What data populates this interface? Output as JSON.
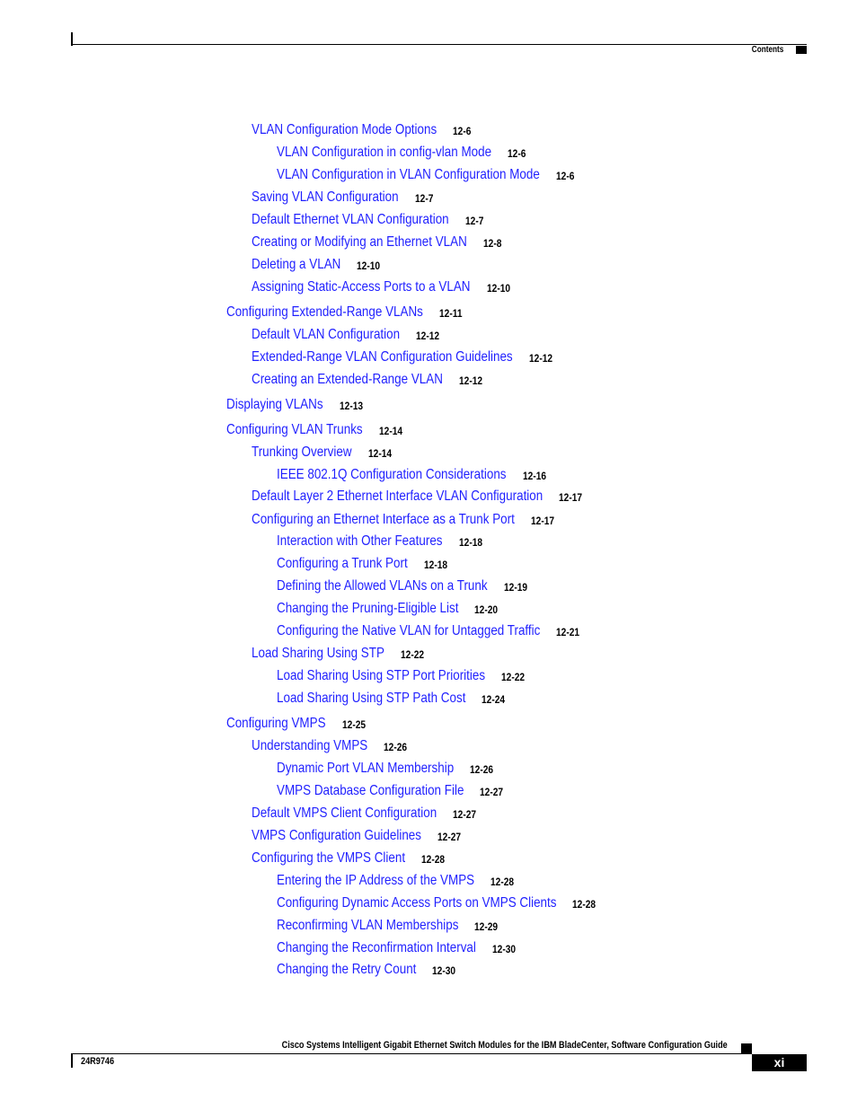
{
  "header": {
    "section_label": "Contents"
  },
  "toc": {
    "entries": [
      {
        "level": 2,
        "title": "VLAN Configuration Mode Options",
        "page": "12-6"
      },
      {
        "level": 3,
        "title": "VLAN Configuration in config-vlan Mode",
        "page": "12-6"
      },
      {
        "level": 3,
        "title": "VLAN Configuration in VLAN Configuration Mode",
        "page": "12-6"
      },
      {
        "level": 2,
        "title": "Saving VLAN Configuration",
        "page": "12-7"
      },
      {
        "level": 2,
        "title": "Default Ethernet VLAN Configuration",
        "page": "12-7"
      },
      {
        "level": 2,
        "title": "Creating or Modifying an Ethernet VLAN",
        "page": "12-8"
      },
      {
        "level": 2,
        "title": "Deleting a VLAN",
        "page": "12-10"
      },
      {
        "level": 2,
        "title": "Assigning Static-Access Ports to a VLAN",
        "page": "12-10"
      },
      {
        "level": 1,
        "title": "Configuring Extended-Range VLANs",
        "page": "12-11"
      },
      {
        "level": 2,
        "title": "Default VLAN Configuration",
        "page": "12-12"
      },
      {
        "level": 2,
        "title": "Extended-Range VLAN Configuration Guidelines",
        "page": "12-12"
      },
      {
        "level": 2,
        "title": "Creating an Extended-Range VLAN",
        "page": "12-12"
      },
      {
        "level": 1,
        "title": "Displaying VLANs",
        "page": "12-13"
      },
      {
        "level": 1,
        "title": "Configuring VLAN Trunks",
        "page": "12-14"
      },
      {
        "level": 2,
        "title": "Trunking Overview",
        "page": "12-14"
      },
      {
        "level": 3,
        "title": "IEEE 802.1Q Configuration Considerations",
        "page": "12-16"
      },
      {
        "level": 2,
        "title": "Default Layer 2 Ethernet Interface VLAN Configuration",
        "page": "12-17"
      },
      {
        "level": 2,
        "title": "Configuring an Ethernet Interface as a Trunk Port",
        "page": "12-17"
      },
      {
        "level": 3,
        "title": "Interaction with Other Features",
        "page": "12-18"
      },
      {
        "level": 3,
        "title": "Configuring a Trunk Port",
        "page": "12-18"
      },
      {
        "level": 3,
        "title": "Defining the Allowed VLANs on a Trunk",
        "page": "12-19"
      },
      {
        "level": 3,
        "title": "Changing the Pruning-Eligible List",
        "page": "12-20"
      },
      {
        "level": 3,
        "title": "Configuring the Native VLAN for Untagged Traffic",
        "page": "12-21"
      },
      {
        "level": 2,
        "title": "Load Sharing Using STP",
        "page": "12-22"
      },
      {
        "level": 3,
        "title": "Load Sharing Using STP Port Priorities",
        "page": "12-22"
      },
      {
        "level": 3,
        "title": "Load Sharing Using STP Path Cost",
        "page": "12-24"
      },
      {
        "level": 1,
        "title": "Configuring VMPS",
        "page": "12-25"
      },
      {
        "level": 2,
        "title": "Understanding VMPS",
        "page": "12-26"
      },
      {
        "level": 3,
        "title": "Dynamic Port VLAN Membership",
        "page": "12-26"
      },
      {
        "level": 3,
        "title": "VMPS Database Configuration File",
        "page": "12-27"
      },
      {
        "level": 2,
        "title": "Default VMPS Client Configuration",
        "page": "12-27"
      },
      {
        "level": 2,
        "title": "VMPS Configuration Guidelines",
        "page": "12-27"
      },
      {
        "level": 2,
        "title": "Configuring the VMPS Client",
        "page": "12-28"
      },
      {
        "level": 3,
        "title": "Entering the IP Address of the VMPS",
        "page": "12-28"
      },
      {
        "level": 3,
        "title": "Configuring Dynamic Access Ports on VMPS Clients",
        "page": "12-28"
      },
      {
        "level": 3,
        "title": "Reconfirming VLAN Memberships",
        "page": "12-29"
      },
      {
        "level": 3,
        "title": "Changing the Reconfirmation Interval",
        "page": "12-30"
      },
      {
        "level": 3,
        "title": "Changing the Retry Count",
        "page": "12-30"
      }
    ]
  },
  "footer": {
    "book_title": "Cisco Systems Intelligent Gigabit Ethernet Switch Modules for the IBM BladeCenter, Software Configuration Guide",
    "doc_number": "24R9746",
    "page_number": "xi"
  },
  "colors": {
    "link": "#1f1fff",
    "text": "#000000"
  }
}
